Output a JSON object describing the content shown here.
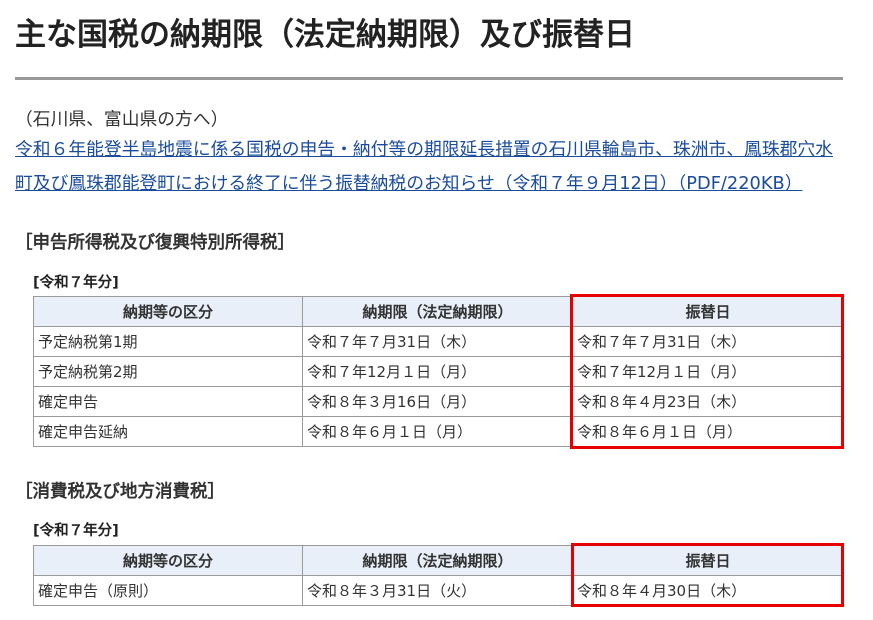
{
  "page": {
    "title": "主な国税の納期限（法定納期限）及び振替日"
  },
  "notice": {
    "audience": "（石川県、富山県の方へ）",
    "link_text": "令和６年能登半島地震に係る国税の申告・納付等の期限延長措置の石川県輪島市、珠洲市、鳳珠郡穴水町及び鳳珠郡能登町における終了に伴う振替納税のお知らせ（令和７年９月12日）（PDF/220KB）"
  },
  "sections": [
    {
      "heading": "［申告所得税及び復興特別所得税］",
      "year_label": "[令和７年分]",
      "table": {
        "headers": [
          "納期等の区分",
          "納期限（法定納期限）",
          "振替日"
        ],
        "rows": [
          [
            "予定納税第1期",
            "令和７年７月31日（木）",
            "令和７年７月31日（木）"
          ],
          [
            "予定納税第2期",
            "令和７年12月１日（月）",
            "令和７年12月１日（月）"
          ],
          [
            "確定申告",
            "令和８年３月16日（月）",
            "令和８年４月23日（木）"
          ],
          [
            "確定申告延納",
            "令和８年６月１日（月）",
            "令和８年６月１日（月）"
          ]
        ]
      }
    },
    {
      "heading": "［消費税及び地方消費税］",
      "year_label": "[令和７年分]",
      "table": {
        "headers": [
          "納期等の区分",
          "納期限（法定納期限）",
          "振替日"
        ],
        "rows": [
          [
            "確定申告（原則）",
            "令和８年３月31日（火）",
            "令和８年４月30日（木）"
          ]
        ]
      }
    }
  ],
  "colors": {
    "highlight": "#e60000",
    "link": "#1a4c9c",
    "table_header_bg": "#e8eff9",
    "rule": "#999999"
  }
}
